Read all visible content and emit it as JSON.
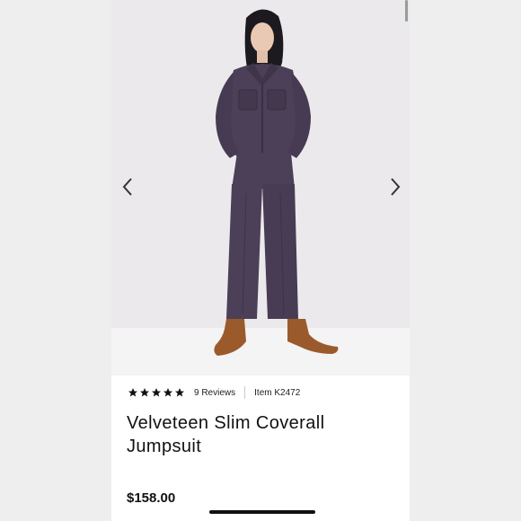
{
  "product": {
    "rating_stars": 5,
    "reviews_label": "9 Reviews",
    "item_label": "Item K2472",
    "title_line1": "Velveteen Slim Coverall",
    "title_line2": "Jumpsuit",
    "price": "$158.00"
  },
  "gallery": {
    "prev_icon": "chevron-left-icon",
    "next_icon": "chevron-right-icon",
    "garment_color": "#4b4057",
    "boot_color": "#9b5a2c"
  },
  "colors": {
    "background": "#ffffff",
    "text": "#111111"
  }
}
